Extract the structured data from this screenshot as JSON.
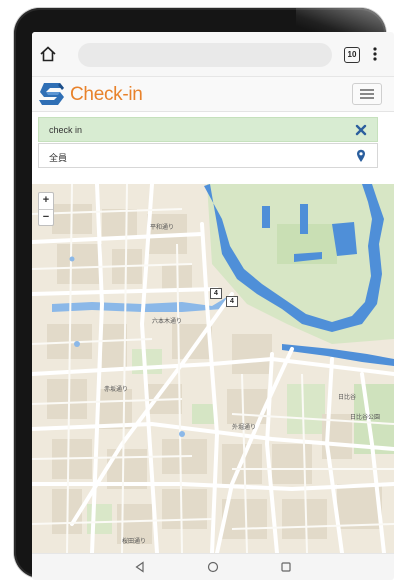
{
  "browser": {
    "tab_count": "10"
  },
  "app": {
    "logo_text": "Check-in",
    "brand_color": "#e8822b",
    "logo_color": "#2f6fb5"
  },
  "status_row": {
    "text": "check in",
    "icon": "close-icon",
    "icon_color": "#2b5f9e"
  },
  "filter_row": {
    "text": "全員",
    "icon": "map-pin-icon"
  },
  "map": {
    "zoom_in_label": "+",
    "zoom_out_label": "−",
    "route_badges": [
      "4",
      "4"
    ],
    "labels": [
      "日比谷",
      "平和通り",
      "日比谷公園",
      "赤坂通り",
      "六本木通り",
      "外堀通り",
      "桜田通り"
    ]
  },
  "nav": {
    "back": "back-icon",
    "home": "home-circle-icon",
    "recent": "recent-apps-icon"
  }
}
